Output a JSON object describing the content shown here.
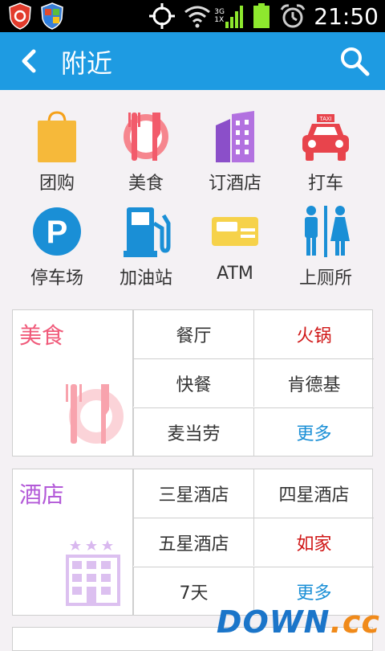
{
  "status_bar": {
    "time": "21:50",
    "network_label": "3G 1X"
  },
  "header": {
    "title": "附近"
  },
  "categories": [
    {
      "label": "团购",
      "icon": "shopping-bag-icon"
    },
    {
      "label": "美食",
      "icon": "fork-knife-plate-icon"
    },
    {
      "label": "订酒店",
      "icon": "hotel-building-icon"
    },
    {
      "label": "打车",
      "icon": "taxi-icon"
    },
    {
      "label": "停车场",
      "icon": "parking-icon"
    },
    {
      "label": "加油站",
      "icon": "gas-station-icon"
    },
    {
      "label": "ATM",
      "icon": "atm-card-icon"
    },
    {
      "label": "上厕所",
      "icon": "restroom-icon"
    }
  ],
  "food_card": {
    "title": "美食",
    "items": [
      "餐厅",
      "火锅",
      "快餐",
      "肯德基",
      "麦当劳",
      "更多"
    ]
  },
  "hotel_card": {
    "title": "酒店",
    "items": [
      "三星酒店",
      "四星酒店",
      "五星酒店",
      "如家",
      "7天",
      "更多"
    ]
  },
  "watermark": {
    "main": "DOWN",
    "suffix": ".cc"
  },
  "colors": {
    "action_bar": "#1e9be2",
    "food_title": "#f05a7a",
    "hotel_title": "#b35ad8",
    "highlight_red": "#d01717",
    "more_blue": "#1a8fd6"
  }
}
